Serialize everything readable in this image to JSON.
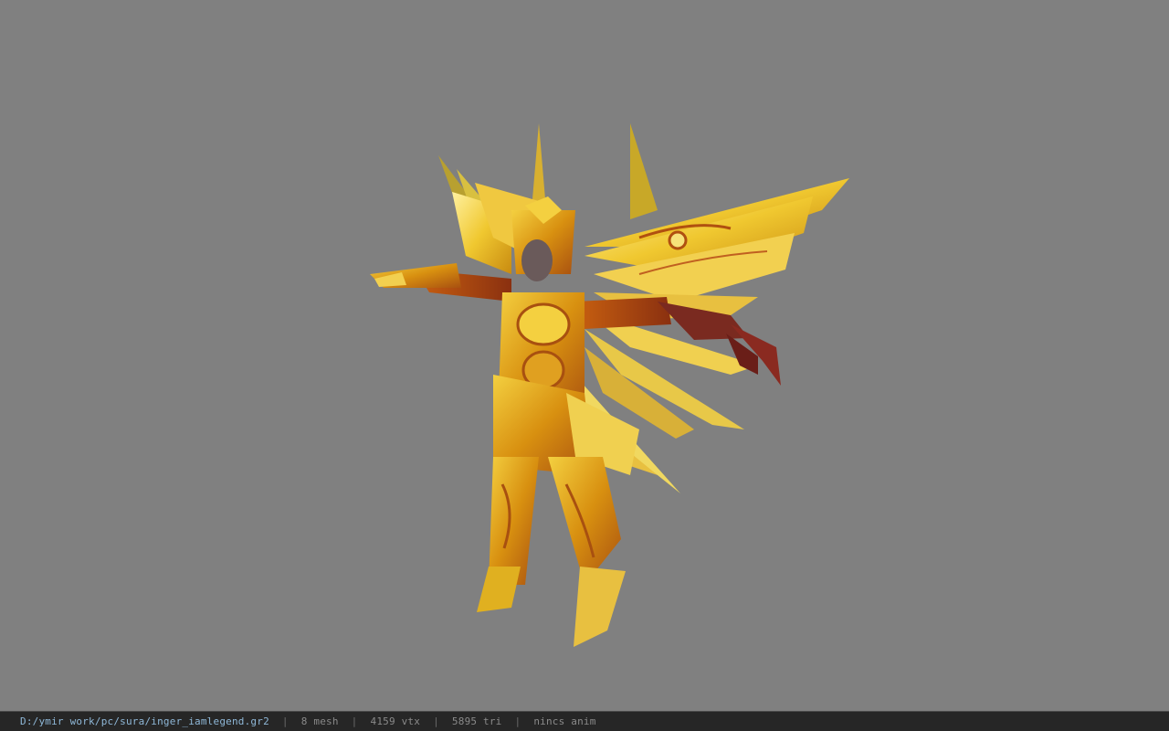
{
  "status_bar": {
    "file_path": "D:/ymir work/pc/sura/inger_iamlegend.gr2",
    "separator": "|",
    "mesh": "8 mesh",
    "vertices": "4159 vtx",
    "triangles": "5895 tri",
    "anim": "nincs anim"
  },
  "viewport": {
    "background_color": "#808080",
    "model_icon": "armored-character-model"
  },
  "colors": {
    "gold_light": "#f6e27a",
    "gold": "#e0b020",
    "gold_dark": "#b07010",
    "armor_red": "#b04a10",
    "claw": "#7a2a20",
    "skin": "#6a5a5a"
  }
}
